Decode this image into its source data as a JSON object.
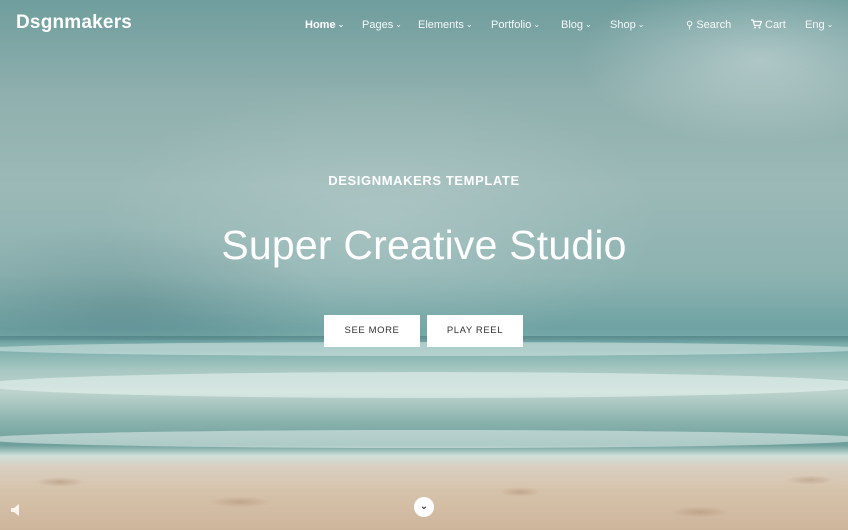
{
  "header": {
    "logo": "Dsgnmakers",
    "nav": [
      {
        "label": "Home",
        "active": true
      },
      {
        "label": "Pages"
      },
      {
        "label": "Elements"
      },
      {
        "label": "Portfolio"
      },
      {
        "label": "Blog"
      },
      {
        "label": "Shop"
      }
    ],
    "search_label": "Search",
    "cart_label": "Cart",
    "language_label": "Eng",
    "chevron_glyph": "⌄",
    "search_glyph": "⚲",
    "cart_glyph": "🛒"
  },
  "hero": {
    "kicker": "DESIGNMAKERS TEMPLATE",
    "headline": "Super Creative Studio",
    "primary_button": "SEE MORE",
    "secondary_button": "PLAY REEL",
    "scroll_glyph": "⌄"
  },
  "colors": {
    "sea": "#7eb0ad",
    "sand": "#d7c4ad",
    "button_bg": "#ffffff",
    "button_text": "#333333"
  },
  "icons": {
    "search": "search-icon",
    "cart": "cart-icon",
    "sound": "speaker-icon",
    "scroll": "chevron-down-icon"
  }
}
